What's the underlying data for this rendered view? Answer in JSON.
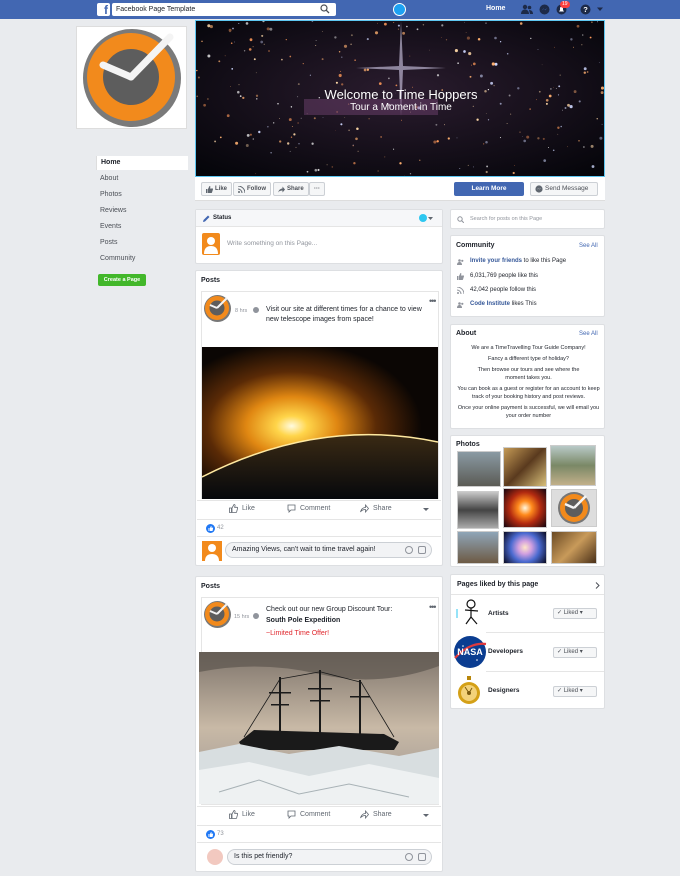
{
  "topbar": {
    "search_value": "Facebook Page Template",
    "home_label": "Home",
    "notif_count": "19",
    "brand_color": "#4267b2"
  },
  "sidebar": {
    "items": [
      {
        "label": "Home"
      },
      {
        "label": "About"
      },
      {
        "label": "Photos"
      },
      {
        "label": "Reviews"
      },
      {
        "label": "Events"
      },
      {
        "label": "Posts"
      },
      {
        "label": "Community"
      }
    ],
    "create_page_label": "Create a Page"
  },
  "cover": {
    "title": "Welcome to Time Hoppers",
    "subtitle": "Tour a Moment in Time"
  },
  "actions": {
    "like": "Like",
    "follow": "Follow",
    "share": "Share",
    "more": "···",
    "learn_more": "Learn More",
    "send_message": "Send Message"
  },
  "status": {
    "label": "Status",
    "placeholder": "Write something on this Page..."
  },
  "right": {
    "search_placeholder": "Search for posts on this Page",
    "community": {
      "title": "Community",
      "see_all": "See All",
      "invite_link": "Invite your friends",
      "invite_rest": " to like this Page",
      "likes": "6,031,769 people like this",
      "follows": "42,042 people follow this",
      "code_link": "Code Institute",
      "code_rest": " likes This"
    },
    "about": {
      "title": "About",
      "see_all": "See All",
      "lines": [
        "We are a TimeTravelling Tour Guide Company!",
        "Fancy a different type of holiday?",
        "Then browse our tours and see where the moment takes you.",
        "You can book as a guest or register for an account to keep track of your booking history and post reviews.",
        "Once your online payment is successful, we will email you your order number"
      ]
    },
    "photos": {
      "title": "Photos"
    },
    "pages_liked": {
      "title": "Pages liked by this page",
      "items": [
        {
          "name": "Artists",
          "button": "Liked"
        },
        {
          "name": "Developers",
          "button": "Liked"
        },
        {
          "name": "Designers",
          "button": "Liked"
        }
      ]
    }
  },
  "posts": [
    {
      "section_title": "Posts",
      "time": "8 hrs",
      "text": "Visit our site at different times for a chance to view new telescope images from space!",
      "like_label": "Like",
      "comment_label": "Comment",
      "share_label": "Share",
      "reaction_count": "42",
      "comment_input": "Amazing Views, can't wait to time travel again!"
    },
    {
      "section_title": "Posts",
      "time": "15 hrs",
      "text": "Check out our new Group Discount Tour:",
      "tour_name": "South Pole Expedition",
      "offer": "~Limited Time Offer!",
      "like_label": "Like",
      "comment_label": "Comment",
      "share_label": "Share",
      "reaction_count": "73",
      "comment_input": "Is this pet friendly?"
    }
  ]
}
